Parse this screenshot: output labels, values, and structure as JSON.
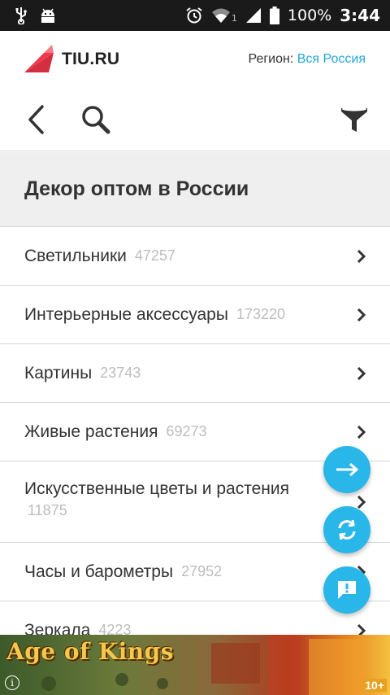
{
  "status_bar": {
    "battery": "100%",
    "time": "3:44",
    "network_index": "1",
    "icons": [
      "usb-icon",
      "android-icon",
      "alarm-icon",
      "wifi-icon",
      "signal-icon",
      "battery-icon"
    ]
  },
  "header": {
    "logo_text": "TIU.RU",
    "region_label": "Регион:",
    "region_value": "Вся Россия"
  },
  "toolbar": {
    "icons": [
      "back-icon",
      "search-icon",
      "filter-icon"
    ]
  },
  "section": {
    "title": "Декор оптом в России"
  },
  "categories": [
    {
      "label": "Светильники",
      "count": "47257"
    },
    {
      "label": "Интерьерные аксессуары",
      "count": "173220"
    },
    {
      "label": "Картины",
      "count": "23743"
    },
    {
      "label": "Живые растения",
      "count": "69273"
    },
    {
      "label": "Искусственные цветы и растения",
      "count": "11875"
    },
    {
      "label": "Часы и барометры",
      "count": "27952"
    },
    {
      "label": "Зеркала",
      "count": "4223"
    }
  ],
  "fabs": [
    "arrow-right-icon",
    "sync-icon",
    "feedback-icon"
  ],
  "ad": {
    "title": "Age of Kings",
    "badge": "10+"
  },
  "colors": {
    "accent": "#29b6e8",
    "link": "#23a6d5",
    "logo": "#ee3a4b",
    "status_bar": "#1a1a1a"
  }
}
